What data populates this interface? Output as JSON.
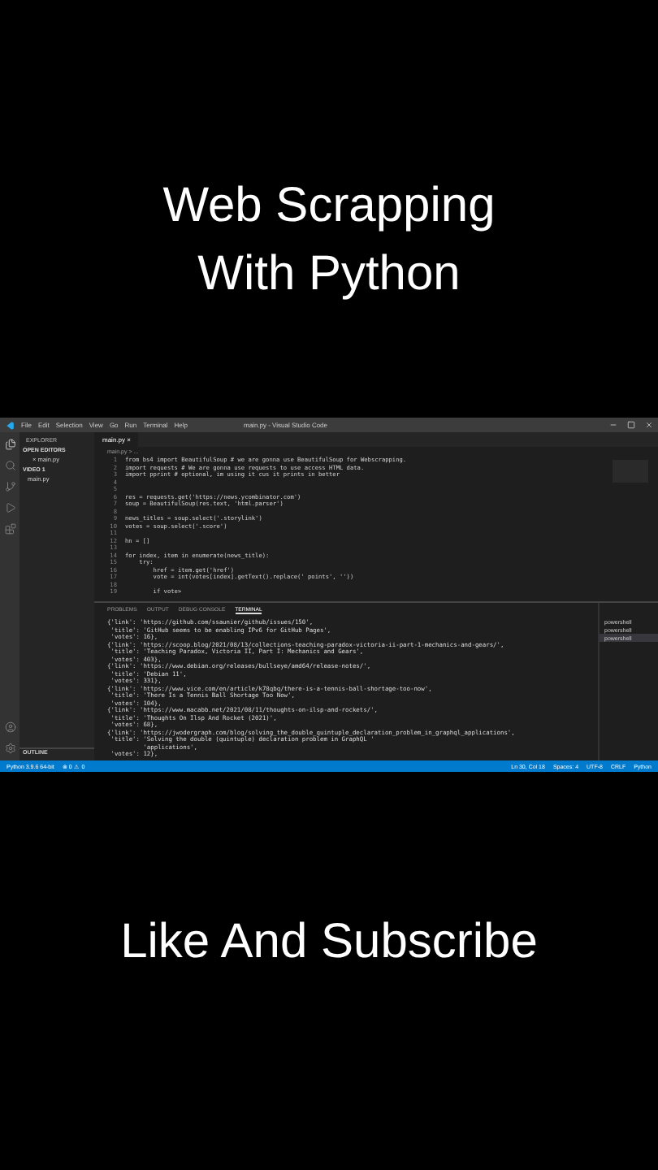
{
  "heading": [
    "Web Scrapping",
    "With Python"
  ],
  "window": {
    "menu": [
      "File",
      "Edit",
      "Selection",
      "View",
      "Go",
      "Run",
      "Terminal",
      "Help"
    ],
    "title": "main.py - Visual Studio Code",
    "sidebar": {
      "title": "EXPLORER",
      "sections": [
        {
          "label": "OPEN EDITORS",
          "files": [
            "× main.py"
          ]
        },
        {
          "label": "VIDEO 1",
          "files": [
            "main.py"
          ]
        }
      ],
      "outline": "OUTLINE"
    },
    "tab": {
      "label": "main.py",
      "close": "×"
    },
    "breadcrumb": "main.py > ...",
    "code": [
      {
        "n": "1",
        "text": "from bs4 import BeautifulSoup # we are gonna use BeautifulSoup for Webscrapping."
      },
      {
        "n": "2",
        "text": "import requests # We are gonna use requests to use access HTML data."
      },
      {
        "n": "3",
        "text": "import pprint # optional, im using it cus it prints in better"
      },
      {
        "n": "4"
      },
      {
        "n": "5"
      },
      {
        "n": "6",
        "text": "res = requests.get('https://news.ycombinator.com')"
      },
      {
        "n": "7",
        "text": "soup = BeautifulSoup(res.text, 'html.parser')"
      },
      {
        "n": "8"
      },
      {
        "n": "9",
        "text": "news_titles = soup.select('.storylink')"
      },
      {
        "n": "10",
        "text": "votes = soup.select('.score')"
      },
      {
        "n": "11"
      },
      {
        "n": "12",
        "text": "hn = []"
      },
      {
        "n": "13"
      },
      {
        "n": "14",
        "text": "for index, item in enumerate(news_title):"
      },
      {
        "n": "15",
        "text": "    try:"
      },
      {
        "n": "16",
        "text": "        href = item.get('href')"
      },
      {
        "n": "17",
        "text": "        vote = int(votes[index].getText().replace(' points', ''))"
      },
      {
        "n": "18"
      },
      {
        "n": "19",
        "text": "        if vote>"
      }
    ],
    "panel_tabs": [
      {
        "label": "PROBLEMS",
        "selected": false
      },
      {
        "label": "OUTPUT",
        "selected": false
      },
      {
        "label": "DEBUG CONSOLE",
        "selected": false
      },
      {
        "label": "TERMINAL",
        "selected": true
      }
    ],
    "terminal": [
      "{'link': 'https://github.com/ssaunier/github/issues/150',",
      " 'title': 'GitHub seems to be enabling IPv6 for GitHub Pages',",
      " 'votes': 16},",
      "{'link': 'https://scoop.blog/2021/08/13/collections-teaching-paradox-victoria-ii-part-1-mechanics-and-gears/',",
      " 'title': 'Teaching Paradox, Victoria II, Part I: Mechanics and Gears',",
      " 'votes': 403},",
      "{'link': 'https://www.debian.org/releases/bullseye/amd64/release-notes/',",
      " 'title': 'Debian 11',",
      " 'votes': 331},",
      "{'link': 'https://www.vice.com/en/article/k78qbq/there-is-a-tennis-ball-shortage-too-now',",
      " 'title': 'There Is a Tennis Ball Shortage Too Now',",
      " 'votes': 104},",
      "{'link': 'https://www.macabb.net/2021/08/11/thoughts-on-ilsp-and-rockets/',",
      " 'title': 'Thoughts On Ilsp And Rocket (2021)',",
      " 'votes': 68},",
      "{'link': 'https://jwodergraph.com/blog/solving_the_double_quintuple_declaration_problem_in_graphql_applications',",
      " 'title': 'Solving the double (quintuple) declaration problem in GraphQL '",
      "          'applications',",
      " 'votes': 12},"
    ],
    "shells": [
      {
        "label": "powershell",
        "selected": false
      },
      {
        "label": "powershell",
        "selected": false
      },
      {
        "label": "powershell",
        "selected": true
      }
    ],
    "status": {
      "left": [
        "Python 3.9.6 64-bit",
        "⊗ 0 ⚠ 0"
      ],
      "right": [
        "Ln 30, Col 18",
        "Spaces: 4",
        "UTF-8",
        "CRLF",
        "Python"
      ]
    }
  },
  "footer": "Like And Subscribe"
}
